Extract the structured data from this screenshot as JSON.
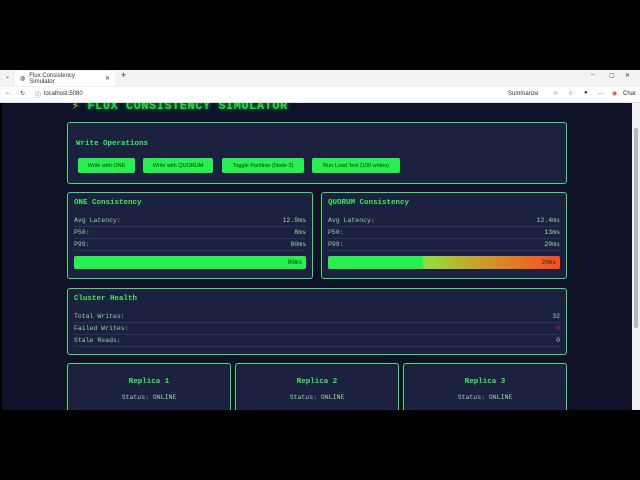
{
  "browser": {
    "tab_title": "Flux Consistency Simulator",
    "url": "localhost:5080",
    "summarize": "Summarize",
    "chat": "Chat"
  },
  "page": {
    "title": "FLUX CONSISTENCY SIMULATOR"
  },
  "write_ops": {
    "heading": "Write Operations",
    "buttons": [
      "Write with ONE",
      "Write with QUORUM",
      "Toggle Partition (Node 3)",
      "Run Load Test (100 writes)"
    ]
  },
  "one": {
    "heading": "ONE Consistency",
    "avg_label": "Avg Latency:",
    "avg": "12.9ms",
    "p50_label": "P50:",
    "p50": "8ms",
    "p99_label": "P99:",
    "p99": "80ms",
    "bar_label": "80ms",
    "bar_fill": 1.0
  },
  "quorum": {
    "heading": "QUORUM Consistency",
    "avg_label": "Avg Latency:",
    "avg": "12.4ms",
    "p50_label": "P50:",
    "p50": "13ms",
    "p99_label": "P99:",
    "p99": "20ms",
    "bar_label": "20ms",
    "bar_fill": 1.0
  },
  "cluster": {
    "heading": "Cluster Health",
    "total_label": "Total Writes:",
    "total": "32",
    "failed_label": "Failed Writes:",
    "failed": "0",
    "stale_label": "Stale Reads:",
    "stale": "0"
  },
  "replicas": [
    {
      "name": "Replica 1",
      "status": "Status: ONLINE"
    },
    {
      "name": "Replica 2",
      "status": "Status: ONLINE"
    },
    {
      "name": "Replica 3",
      "status": "Status: ONLINE"
    }
  ],
  "colors": {
    "accent": "#25f04d",
    "panel": "#1d2140",
    "bg": "#0e1128",
    "danger": "#ff4a1a"
  }
}
